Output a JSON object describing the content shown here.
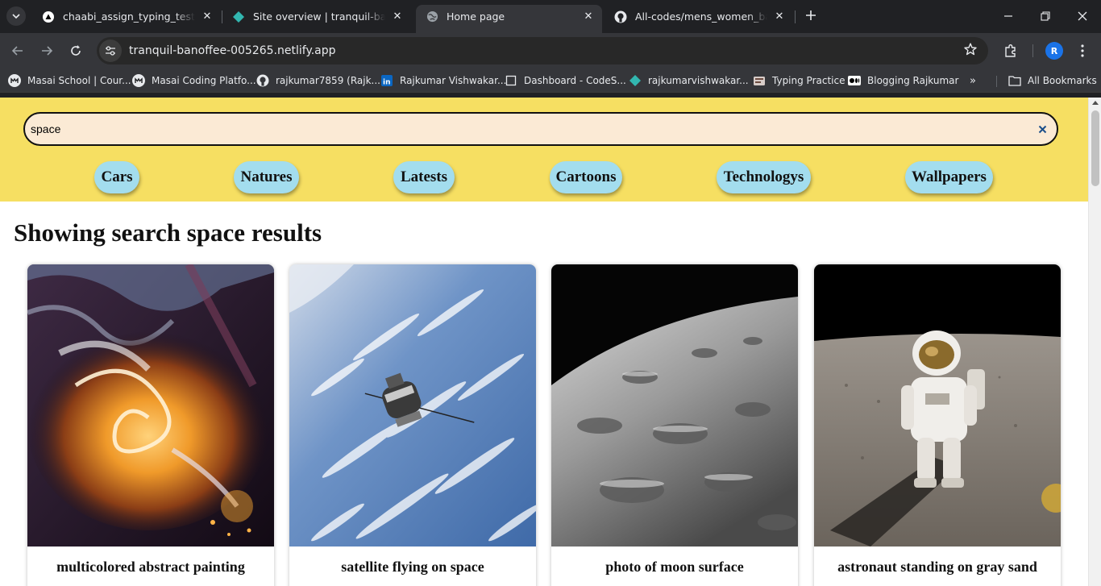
{
  "browser": {
    "tabs": [
      {
        "title": "chaabi_assign_typing_test_react",
        "icon": "vercel-icon"
      },
      {
        "title": "Site overview | tranquil-banoffee",
        "icon": "netlify-icon"
      },
      {
        "title": "Home page",
        "icon": "globe-icon",
        "active": true
      },
      {
        "title": "All-codes/mens_women_bar at",
        "icon": "github-icon"
      }
    ],
    "url": "tranquil-banoffee-005265.netlify.app",
    "profile_initial": "R",
    "bookmarks": [
      {
        "label": "Masai School | Cour...",
        "icon": "masai-icon"
      },
      {
        "label": "Masai Coding Platfo...",
        "icon": "masai-icon"
      },
      {
        "label": "rajkumar7859 (Rajk...",
        "icon": "github-icon"
      },
      {
        "label": "Rajkumar Vishwakar...",
        "icon": "linkedin-icon"
      },
      {
        "label": "Dashboard - CodeS...",
        "icon": "page-icon"
      },
      {
        "label": "rajkumarvishwakar...",
        "icon": "diamond-icon"
      },
      {
        "label": "Typing Practice",
        "icon": "typing-icon"
      },
      {
        "label": "Blogging Rajkumar",
        "icon": "medium-icon"
      }
    ],
    "all_bookmarks_label": "All Bookmarks",
    "more_label": "»"
  },
  "page": {
    "search": {
      "value": "space"
    },
    "categories": [
      "Cars",
      "Natures",
      "Latests",
      "Cartoons",
      "Technologys",
      "Wallpapers"
    ],
    "results_title": "Showing search space results",
    "results": [
      {
        "caption": "multicolored abstract painting"
      },
      {
        "caption": "satellite flying on space"
      },
      {
        "caption": "photo of moon surface"
      },
      {
        "caption": "astronaut standing on gray sand"
      }
    ],
    "colors": {
      "header_bg": "#f6df62",
      "search_bg": "#fbead5",
      "category_bg": "#a3ddee"
    }
  }
}
